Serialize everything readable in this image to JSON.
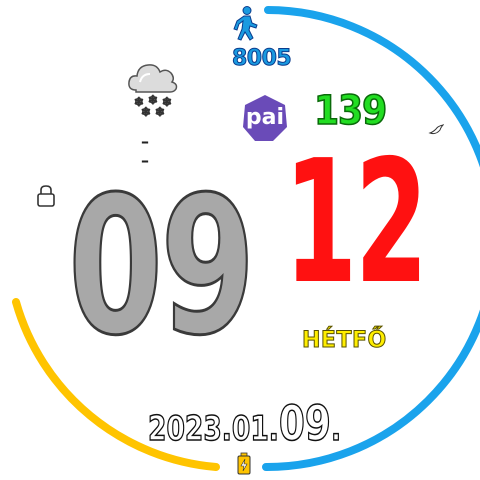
{
  "steps": {
    "value": "8005"
  },
  "pai": {
    "label": "pai",
    "value": "139"
  },
  "weather": {
    "temperature": "– –",
    "condition_icon": "snow-cloud-icon"
  },
  "time": {
    "hour": "09",
    "minute": "12"
  },
  "date": {
    "weekday": "HÉTFŐ",
    "year_month": "2023.01.",
    "day": "09",
    "suffix": "."
  },
  "battery": {
    "level": 0.3,
    "icon": "battery-bolt-icon"
  },
  "steps_progress": {
    "level": 0.78
  },
  "colors": {
    "ring_blue": "#1aa3ec",
    "ring_yellow": "#ffc400",
    "minute_red": "#ff1111",
    "pai_purple": "#6a4bb8",
    "pai_green": "#22dd22",
    "hour_gray": "#a8a8a8",
    "weekday_yellow": "#ffee00"
  },
  "icons": {
    "walker": "walker-icon",
    "lock": "lock-icon",
    "dnd": "moon-icon"
  }
}
